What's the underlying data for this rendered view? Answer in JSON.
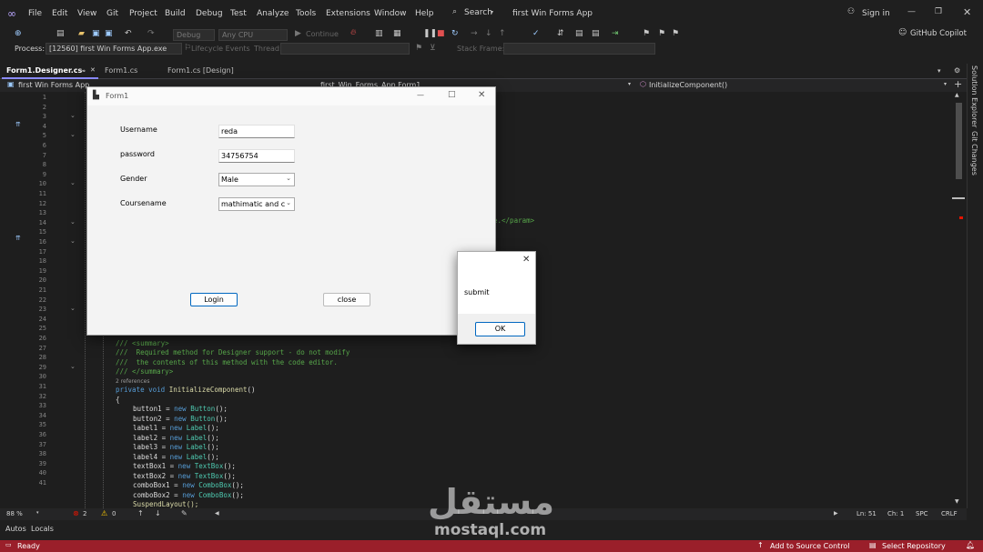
{
  "menu": {
    "items": [
      "File",
      "Edit",
      "View",
      "Git",
      "Project",
      "Build",
      "Debug",
      "Test",
      "Analyze",
      "Tools",
      "Extensions",
      "Window",
      "Help"
    ],
    "search_label": "Search",
    "solution_title": "first Win Forms App",
    "sign_in": "Sign in",
    "copilot": "GitHub Copilot"
  },
  "toolbar": {
    "config": "Debug",
    "platform": "Any CPU",
    "continue_label": "Continue"
  },
  "process_bar": {
    "process_label": "Process:",
    "process_value": "[12560] first Win Forms App.exe",
    "lifecycle_label": "Lifecycle Events",
    "thread_label": "Thread:",
    "stack_frame_label": "Stack Frame:"
  },
  "tabs": [
    {
      "label": "Form1.Designer.cs",
      "active": true
    },
    {
      "label": "Form1.cs",
      "active": false
    },
    {
      "label": "Form1.cs [Design]",
      "active": false
    }
  ],
  "nav": {
    "project": "first Win Forms App",
    "class_path": "first_Win_Forms_App.Form1",
    "member": "InitializeComponent()"
  },
  "editor": {
    "line_numbers": [
      "1",
      "2",
      "3",
      "4",
      "5",
      "6",
      "7",
      "8",
      "9",
      "10",
      "11",
      "12",
      "13",
      "14",
      "15",
      "16",
      "17",
      "18",
      "19",
      "20",
      "21",
      "22",
      "23",
      "24",
      "25",
      "26",
      "27",
      "28",
      "29",
      "30",
      "31",
      "32",
      "33",
      "34",
      "35",
      "36",
      "37",
      "38",
      "39",
      "40",
      "41"
    ],
    "param_fragment": "e.</param>",
    "comment_lines": [
      "/// <summary>",
      "///  Required method for Designer support - do not modify",
      "///  the contents of this method with the code editor.",
      "/// </summary>"
    ],
    "references": "2 references",
    "signature": {
      "kw1": "private",
      "kw2": "void",
      "name": "InitializeComponent",
      "rest": "()"
    },
    "open_brace": "{",
    "assignments": [
      {
        "var": "button1",
        "type": "Button"
      },
      {
        "var": "button2",
        "type": "Button"
      },
      {
        "var": "label1",
        "type": "Label"
      },
      {
        "var": "label2",
        "type": "Label"
      },
      {
        "var": "label3",
        "type": "Label"
      },
      {
        "var": "label4",
        "type": "Label"
      },
      {
        "var": "textBox1",
        "type": "TextBox"
      },
      {
        "var": "textBox2",
        "type": "TextBox"
      },
      {
        "var": "comboBox1",
        "type": "ComboBox"
      },
      {
        "var": "comboBox2",
        "type": "ComboBox"
      }
    ],
    "suspend": "SuspendLayout();"
  },
  "status_info": {
    "zoom": "88 %",
    "errors": "2",
    "warnings": "0",
    "line": "Ln: 51",
    "char": "Ch: 1",
    "spc": "SPC",
    "crlf": "CRLF"
  },
  "bottom_tabs": [
    "Autos",
    "Locals"
  ],
  "statusbar": {
    "ready": "Ready",
    "add_source": "Add to Source Control",
    "select_repo": "Select Repository"
  },
  "right_rail": {
    "solution_explorer": "Solution Explorer",
    "git_changes": "Git Changes"
  },
  "form1": {
    "title": "Form1",
    "fields": [
      {
        "label": "Username",
        "value": "reda",
        "kind": "text"
      },
      {
        "label": "password",
        "value": "34756754",
        "kind": "text"
      },
      {
        "label": "Gender",
        "value": "Male",
        "kind": "combo"
      },
      {
        "label": "Coursename",
        "value": "mathimatic and co",
        "kind": "combo"
      }
    ],
    "login_label": "Login",
    "close_label": "close"
  },
  "message_box": {
    "text": "submit",
    "ok_label": "OK"
  },
  "watermark": {
    "arabic": "مستقل",
    "latin": "mostaql.com"
  },
  "colors": {
    "accent": "#8b8bff",
    "statusbar": "#9a1f2a",
    "error": "#e51400",
    "warning": "#ffcc00"
  }
}
